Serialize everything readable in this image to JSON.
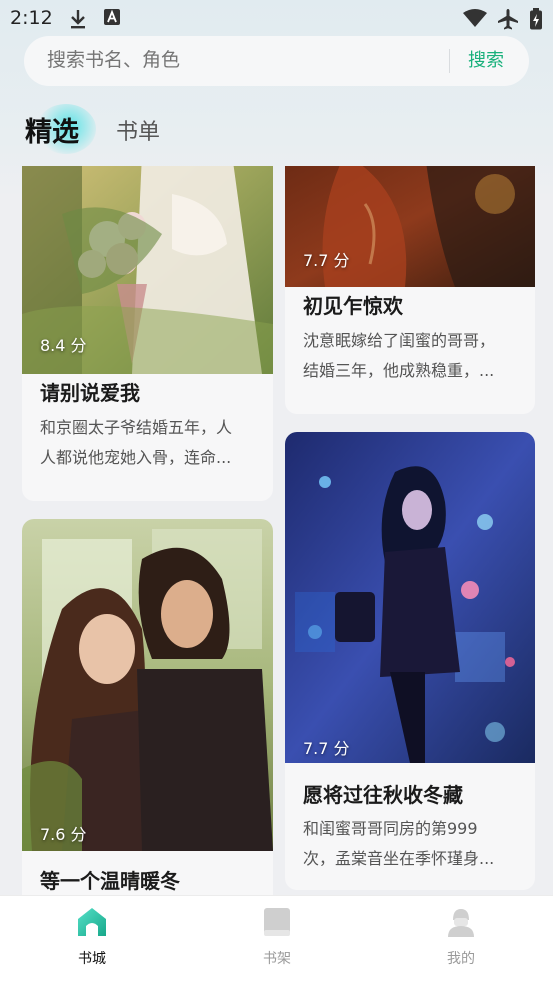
{
  "status_bar": {
    "time": "2:12"
  },
  "search": {
    "placeholder": "搜索书名、角色",
    "button_label": "搜索"
  },
  "tabs": [
    {
      "label": "精选",
      "active": true
    },
    {
      "label": "书单",
      "active": false
    }
  ],
  "books": [
    {
      "score": "8.4 分",
      "title": "请别说爱我",
      "desc_lines": [
        "和京圈太子爷结婚五年，人",
        "人都说他宠她入骨，连命..."
      ]
    },
    {
      "score": "7.7 分",
      "title": "初见乍惊欢",
      "desc_lines": [
        "沈意眠嫁给了闺蜜的哥哥，",
        "结婚三年，他成熟稳重，..."
      ]
    },
    {
      "score": "7.6 分",
      "title": "等一个温晴暖冬",
      "desc_lines": []
    },
    {
      "score": "7.7 分",
      "title": "愿将过往秋收冬藏",
      "desc_lines": [
        "和闺蜜哥哥同房的第999",
        "次，孟棠音坐在季怀瑾身..."
      ]
    }
  ],
  "bottom_nav": [
    {
      "label": "书城",
      "icon": "home-icon",
      "active": true
    },
    {
      "label": "书架",
      "icon": "book-icon",
      "active": false
    },
    {
      "label": "我的",
      "icon": "profile-icon",
      "active": false
    }
  ],
  "colors": {
    "accent": "#18b07b",
    "nav_active": "#111111",
    "nav_inactive": "#9a9a9a"
  }
}
